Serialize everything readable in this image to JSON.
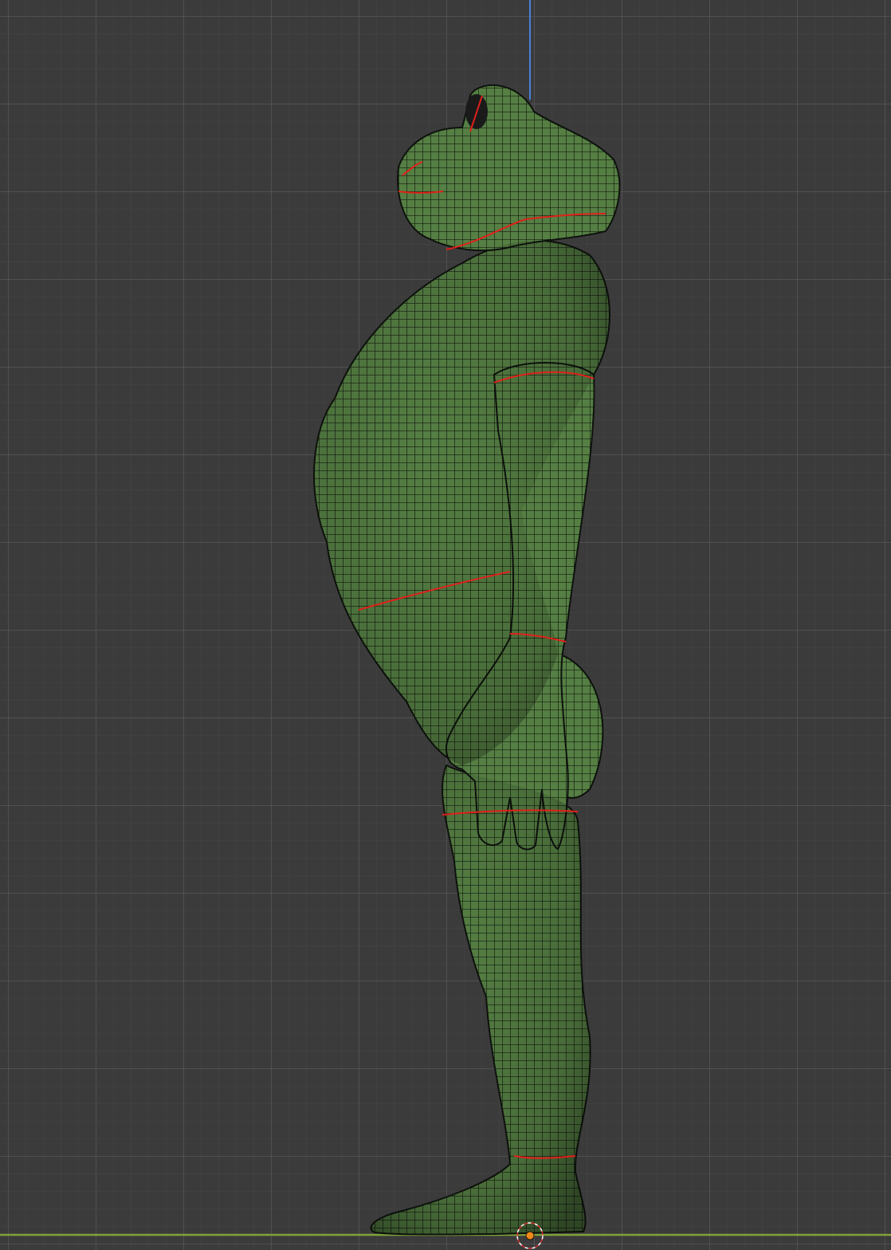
{
  "viewport": {
    "view": "side-orthographic",
    "background_color": "#3b3b3b",
    "grid_minor_color": "#444444",
    "grid_major_color": "#555555",
    "z_axis_color": "#4a7fd9",
    "y_axis_color": "#7fa33a"
  },
  "object": {
    "name": "frog-character-mesh",
    "shading": "wireframe-over-solid",
    "base_color": "#4f7a3e",
    "wire_color": "#111611",
    "seam_color": "#e0201a"
  },
  "origin_marker": {
    "color": "#f08a1e"
  },
  "icons": {
    "origin": "origin-dot-icon",
    "cursor": "3d-cursor-icon"
  }
}
